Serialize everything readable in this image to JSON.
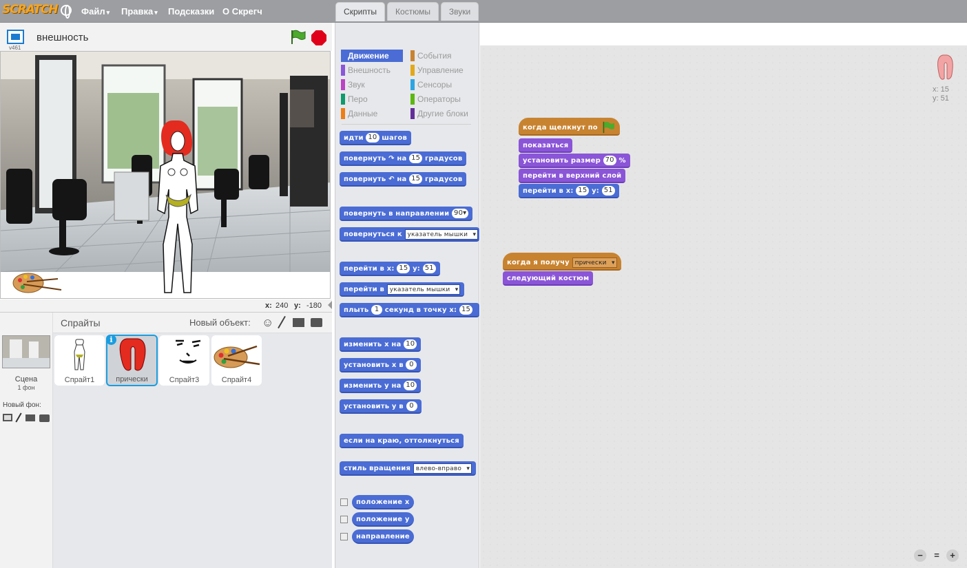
{
  "topbar": {
    "logo": "SCRATCH",
    "menu": [
      {
        "label": "Файл",
        "arrow": "▾"
      },
      {
        "label": "Правка",
        "arrow": "▾"
      },
      {
        "label": "Подсказки",
        "arrow": ""
      },
      {
        "label": "О Скрегч",
        "arrow": ""
      }
    ]
  },
  "stage": {
    "version": "v461",
    "sprite_name": "внешность",
    "coords": {
      "x_label": "x:",
      "x": "240",
      "y_label": "y:",
      "y": "-180"
    }
  },
  "sprites": {
    "title": "Спрайты",
    "new_object": "Новый объект:",
    "stage_label": "Сцена",
    "stage_sub": "1 фон",
    "new_bg": "Новый фон:",
    "items": [
      {
        "name": "Спрайт1"
      },
      {
        "name": "прически"
      },
      {
        "name": "Спрайт3"
      },
      {
        "name": "Спрайт4"
      }
    ]
  },
  "tabs": [
    "Скрипты",
    "Костюмы",
    "Звуки"
  ],
  "categories": [
    {
      "label": "Движение",
      "color": "#4a6cd4"
    },
    {
      "label": "События",
      "color": "#c88330"
    },
    {
      "label": "Внешность",
      "color": "#8a55d7"
    },
    {
      "label": "Управление",
      "color": "#e1a91a"
    },
    {
      "label": "Звук",
      "color": "#bb42c3"
    },
    {
      "label": "Сенсоры",
      "color": "#2ca5e2"
    },
    {
      "label": "Перо",
      "color": "#0e9a6c"
    },
    {
      "label": "Операторы",
      "color": "#5cb712"
    },
    {
      "label": "Данные",
      "color": "#ee7d16"
    },
    {
      "label": "Другие блоки",
      "color": "#632d99"
    }
  ],
  "palette": {
    "move": {
      "t1": "идти",
      "v": "10",
      "t2": "шагов"
    },
    "turn_r": {
      "t1": "повернуть",
      "t2": "на",
      "v": "15",
      "t3": "градусов"
    },
    "turn_l": {
      "t1": "повернуть",
      "t2": "на",
      "v": "15",
      "t3": "градусов"
    },
    "point_dir": {
      "t1": "повернуть в направлении",
      "v": "90▾"
    },
    "point_to": {
      "t1": "повернуться к",
      "v": "указатель мышки"
    },
    "goto_xy": {
      "t1": "перейти в x:",
      "x": "15",
      "t2": "y:",
      "y": "51"
    },
    "goto": {
      "t1": "перейти в",
      "v": "указатель мышки"
    },
    "glide": {
      "t1": "плыть",
      "v": "1",
      "t2": "секунд в точку x:",
      "x": "15"
    },
    "change_x": {
      "t1": "изменить х на",
      "v": "10"
    },
    "set_x": {
      "t1": "установить х в",
      "v": "0"
    },
    "change_y": {
      "t1": "изменить у на",
      "v": "10"
    },
    "set_y": {
      "t1": "установить у в",
      "v": "0"
    },
    "bounce": "если на краю, оттолкнуться",
    "rot_style": {
      "t1": "стиль вращения",
      "v": "влево-вправо"
    },
    "rep_x": "положение x",
    "rep_y": "положение y",
    "rep_dir": "направление"
  },
  "scripts": {
    "sprite_x": "x: 15",
    "sprite_y": "y: 51",
    "s1": {
      "hat": "когда щелкнут по",
      "show": "показаться",
      "size": {
        "t1": "установить размер",
        "v": "70",
        "t2": "%"
      },
      "front": "перейти в верхний слой",
      "goto": {
        "t1": "перейти в x:",
        "x": "15",
        "t2": "y:",
        "y": "51"
      }
    },
    "s2": {
      "hat": "когда я получу",
      "msg": "прически",
      "next": "следующий костюм"
    }
  }
}
